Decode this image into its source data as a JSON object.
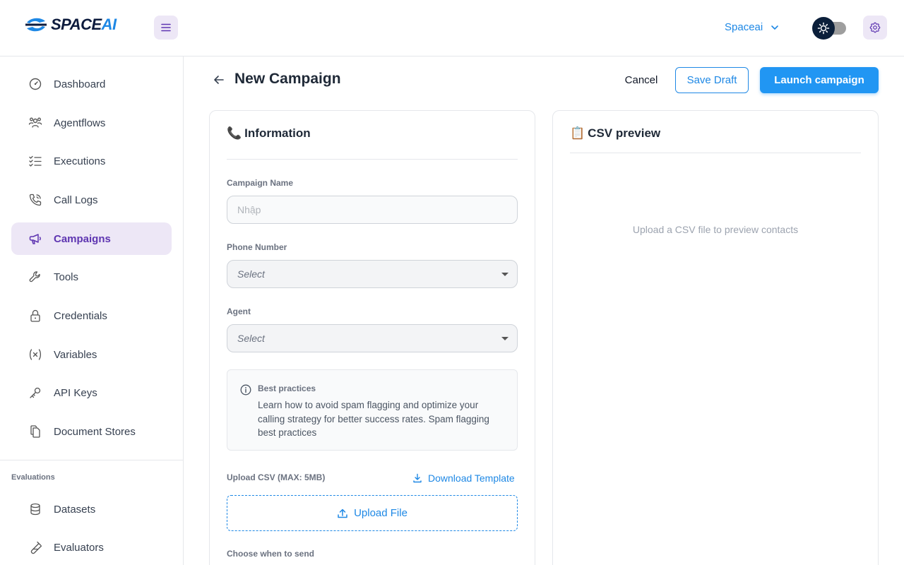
{
  "header": {
    "logo_main": "SPACE",
    "logo_accent": "AI",
    "workspace": "Spaceai"
  },
  "sidebar": {
    "items": [
      {
        "label": "Dashboard",
        "icon": "gauge-icon"
      },
      {
        "label": "Agentflows",
        "icon": "users-icon"
      },
      {
        "label": "Executions",
        "icon": "checklist-icon"
      },
      {
        "label": "Call Logs",
        "icon": "phone-call-icon"
      },
      {
        "label": "Campaigns",
        "icon": "megaphone-icon",
        "active": true
      },
      {
        "label": "Tools",
        "icon": "wrench-icon"
      },
      {
        "label": "Credentials",
        "icon": "lock-icon"
      },
      {
        "label": "Variables",
        "icon": "variable-icon"
      },
      {
        "label": "API Keys",
        "icon": "key-icon"
      },
      {
        "label": "Document Stores",
        "icon": "files-icon"
      }
    ],
    "section_label": "Evaluations",
    "eval_items": [
      {
        "label": "Datasets",
        "icon": "database-icon"
      },
      {
        "label": "Evaluators",
        "icon": "test-pipe-icon"
      }
    ]
  },
  "page": {
    "title": "New Campaign",
    "cancel": "Cancel",
    "save_draft": "Save Draft",
    "launch": "Launch campaign"
  },
  "info_card": {
    "emoji": "📞",
    "title": "Information",
    "campaign_name_label": "Campaign Name",
    "campaign_name_placeholder": "Nhập",
    "campaign_name_value": "",
    "phone_label": "Phone Number",
    "phone_value": "Select",
    "agent_label": "Agent",
    "agent_value": "Select",
    "tip_title": "Best practices",
    "tip_body": "Learn how to avoid spam flagging and optimize your calling strategy for better success rates. Spam flagging best practices",
    "upload_label": "Upload CSV (MAX: 5MB)",
    "download_template": "Download Template",
    "upload_button": "Upload File",
    "choose_label": "Choose when to send"
  },
  "preview_card": {
    "emoji": "📋",
    "title": "CSV preview",
    "empty_text": "Upload a CSV file to preview contacts"
  },
  "colors": {
    "accent": "#1e88e5",
    "brand_purple": "#5e35b1",
    "active_bg": "#ede7f6"
  }
}
